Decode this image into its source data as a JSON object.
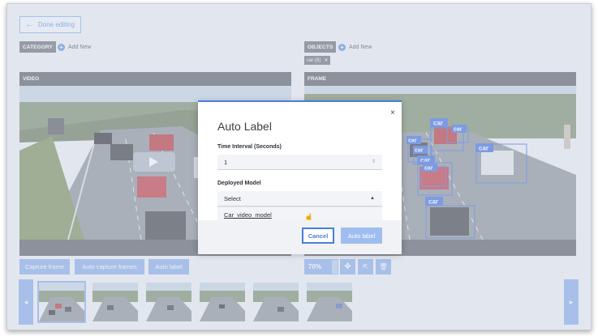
{
  "toolbar": {
    "done_label": "Done editing"
  },
  "category": {
    "header": "CATEGORY",
    "add_new": "Add New"
  },
  "objects": {
    "header": "OBJECTS",
    "add_new": "Add New",
    "chips": [
      {
        "label": "car (8)",
        "remove": "✕"
      }
    ]
  },
  "video_panel": {
    "header": "VIDEO"
  },
  "frame_panel": {
    "header": "FRAME",
    "boxes": [
      {
        "label": "car"
      },
      {
        "label": "car"
      },
      {
        "label": "car"
      },
      {
        "label": "car"
      },
      {
        "label": "car"
      },
      {
        "label": "car"
      },
      {
        "label": "car"
      },
      {
        "label": "car"
      }
    ]
  },
  "video_actions": {
    "capture_frame": "Capture frame",
    "auto_capture": "Auto capture frames",
    "auto_label": "Auto label"
  },
  "frame_tools": {
    "zoom": "70%"
  },
  "filmstrip": {
    "prev": "◂",
    "next": "▸",
    "thumbnail_count": 6
  },
  "modal": {
    "title": "Auto Label",
    "close": "×",
    "time_interval_label": "Time Interval (Seconds)",
    "time_interval_value": "1",
    "deployed_model_label": "Deployed Model",
    "select_value": "Select",
    "options": [
      "Car_video_model"
    ],
    "cancel": "Cancel",
    "auto_label": "Auto label"
  },
  "colors": {
    "accent": "#4a7fd6",
    "button": "#8aaeea",
    "header": "#5a5e66",
    "box": "#3f6fe0"
  }
}
